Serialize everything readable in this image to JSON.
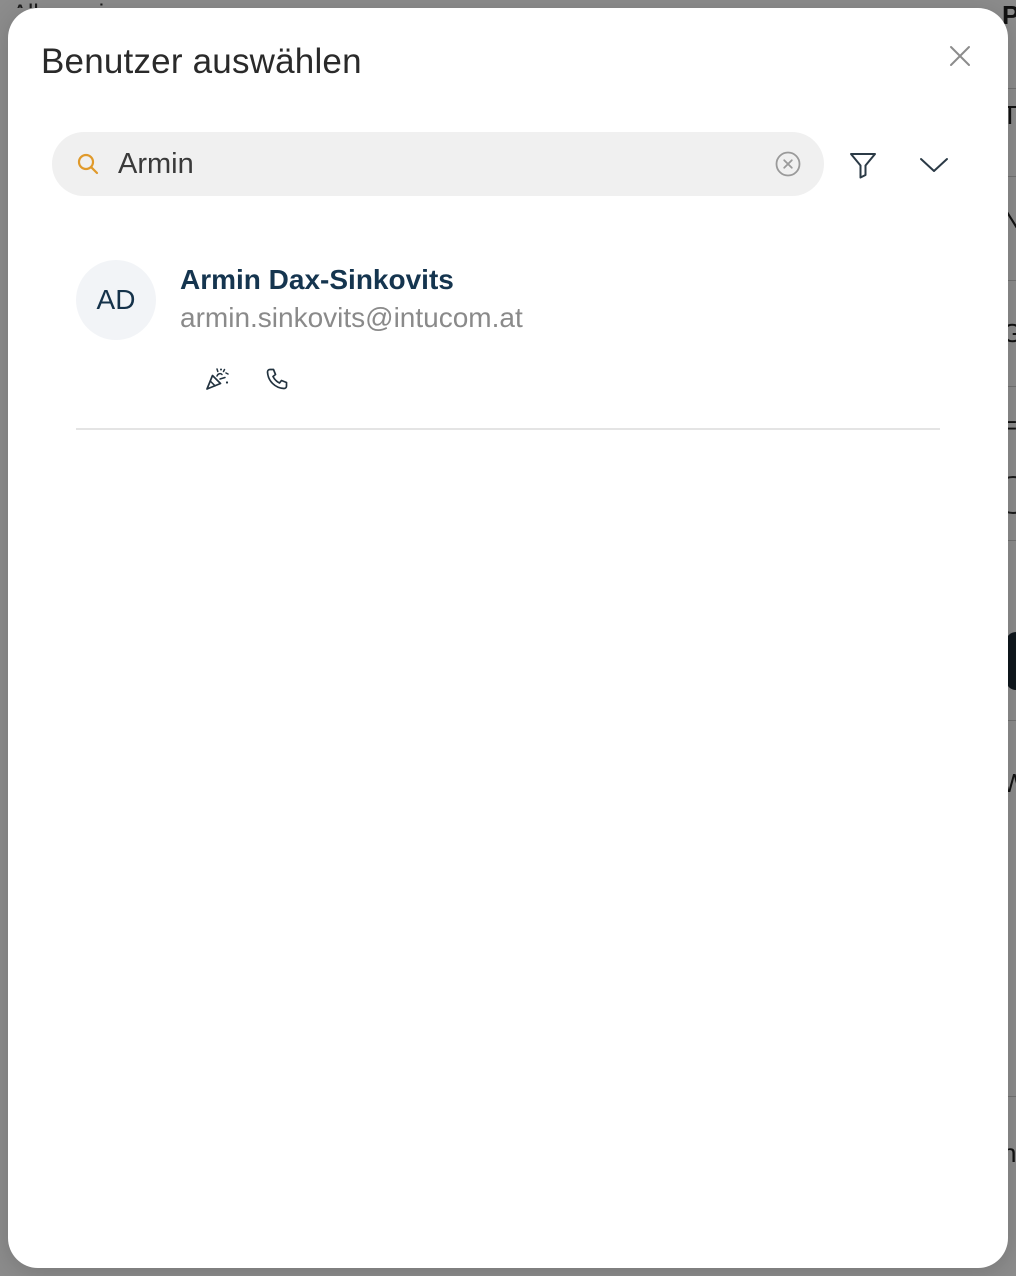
{
  "modal": {
    "title": "Benutzer auswählen",
    "close_icon": "close-icon"
  },
  "search": {
    "value": "Armin",
    "placeholder": "Suchen",
    "icon": "search-icon",
    "clear_icon": "clear-circle-icon",
    "accent_color": "#e09a2b"
  },
  "toolbar": {
    "filter_icon": "filter-icon",
    "expand_icon": "chevron-down-icon"
  },
  "users": [
    {
      "initials": "AD",
      "name": "Armin Dax-Sinkovits",
      "email": "armin.sinkovits@intucom.at",
      "actions": [
        "party-popper-icon",
        "phone-icon"
      ]
    }
  ],
  "colors": {
    "name": "#15354f",
    "email": "#8a8a8a",
    "avatar_bg": "#f2f4f7"
  }
}
